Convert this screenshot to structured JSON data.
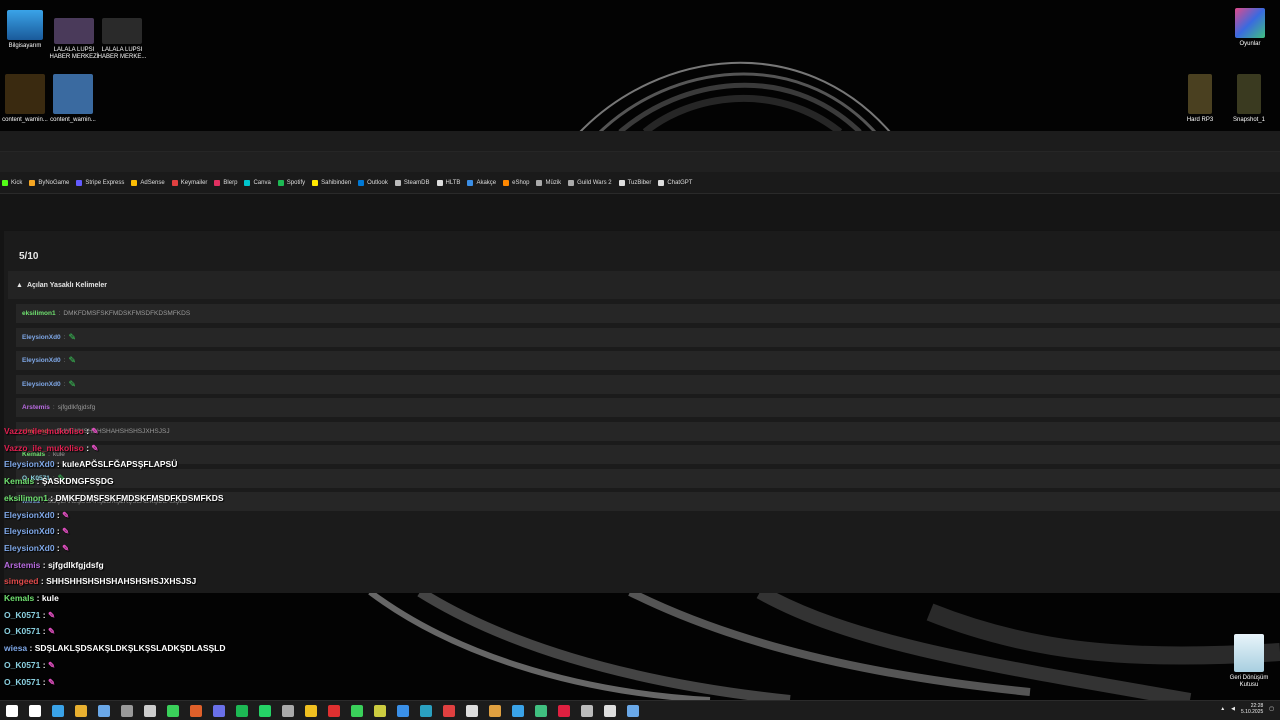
{
  "desktop": {
    "icons_left": [
      {
        "label": "Bilgisayarım",
        "color": "#3aa3e8"
      },
      {
        "label": "LALALA LUPSI HABER MERKEZİ",
        "color": "#4a3a5a"
      },
      {
        "label": "LALALA LUPSI HABER MERKE...",
        "color": "#2a2a2a"
      },
      {
        "label": "content_warnin...",
        "color": "#3a2a10"
      },
      {
        "label": "content_warnin...",
        "color": "#3a6aa0"
      }
    ],
    "icons_right": [
      {
        "label": "Oyunlar",
        "color": "#d04a8a"
      },
      {
        "label": "Hard RP3",
        "color": "#4a4020"
      },
      {
        "label": "Snapshot_1",
        "color": "#3a3a20"
      },
      {
        "label": "Geri Dönüşüm Kutusu",
        "color": "#cfe6f2"
      }
    ]
  },
  "browser": {
    "bookmarks": [
      {
        "label": "Kick",
        "color": "#53fc18"
      },
      {
        "label": "ByNoGame",
        "color": "#f5a623"
      },
      {
        "label": "Stripe Express",
        "color": "#635bff"
      },
      {
        "label": "AdSense",
        "color": "#fbbc04"
      },
      {
        "label": "Keymailer",
        "color": "#e04040"
      },
      {
        "label": "Blerp",
        "color": "#e03060"
      },
      {
        "label": "Canva",
        "color": "#00c4cc"
      },
      {
        "label": "Spotify",
        "color": "#1db954"
      },
      {
        "label": "Sahibinden",
        "color": "#ffe800"
      },
      {
        "label": "Outlook",
        "color": "#0078d4"
      },
      {
        "label": "SteamDB",
        "color": "#bbbbbb"
      },
      {
        "label": "HLTB",
        "color": "#dddddd"
      },
      {
        "label": "Akakçe",
        "color": "#3a8ee6"
      },
      {
        "label": "eShop",
        "color": "#ff8800"
      },
      {
        "label": "Müzik",
        "color": "#aaaaaa"
      },
      {
        "label": "Guild Wars 2",
        "color": "#aaaaaa"
      },
      {
        "label": "TuzBiber",
        "color": "#dddddd"
      },
      {
        "label": "ChatGPT",
        "color": "#dddddd"
      }
    ],
    "score": "5/10",
    "banned_header": "Açılan Yasaklı Kelimeler",
    "banned_rows": [
      {
        "user": "eksilimon1",
        "user_color": "#6fe06f",
        "message": "DMKFDMSFSKFMDSKFMSDFKDSMFKDS"
      },
      {
        "user": "EleysionXd0",
        "user_color": "#7fa8e8",
        "message": ""
      },
      {
        "user": "EleysionXd0",
        "user_color": "#7fa8e8",
        "message": ""
      },
      {
        "user": "EleysionXd0",
        "user_color": "#7fa8e8",
        "message": ""
      },
      {
        "user": "Arstemis",
        "user_color": "#b86be0",
        "message": "sjfgdlkfgjdsfg"
      },
      {
        "user": "simgeed",
        "user_color": "#e04a4a",
        "message": "SHHSHHSHSHSHAHSHSHSJXHSJSJ"
      },
      {
        "user": "Kemals",
        "user_color": "#6fe06f",
        "message": "kule"
      },
      {
        "user": "O_K0571",
        "user_color": "#8ad0e0",
        "message": ""
      },
      {
        "user": "wiesa",
        "user_color": "#7fa8e8",
        "message": "SDŞLAKLŞDSAKŞLDKŞLKŞSLADKŞDLASŞLD"
      }
    ]
  },
  "chat_overlay": [
    {
      "user": "Vazzo_ile_mukoliso",
      "user_color": "#e02050",
      "message": ""
    },
    {
      "user": "Vazzo_ile_mukoliso",
      "user_color": "#e02050",
      "message": ""
    },
    {
      "user": "EleysionXd0",
      "user_color": "#7fa8e8",
      "message": "kuleAPĞSLFĞAPSŞFLAPSÜ"
    },
    {
      "user": "Kemals",
      "user_color": "#6fe06f",
      "message": "ŞASKDNGFSŞDG"
    },
    {
      "user": "eksilimon1",
      "user_color": "#6fe06f",
      "message": "DMKFDMSFSKFMDSKFMSDFKDSMFKDS"
    },
    {
      "user": "EleysionXd0",
      "user_color": "#7fa8e8",
      "message": ""
    },
    {
      "user": "EleysionXd0",
      "user_color": "#7fa8e8",
      "message": ""
    },
    {
      "user": "EleysionXd0",
      "user_color": "#7fa8e8",
      "message": ""
    },
    {
      "user": "Arstemis",
      "user_color": "#b86be0",
      "message": "sjfgdlkfgjdsfg"
    },
    {
      "user": "simgeed",
      "user_color": "#e04a4a",
      "message": "SHHSHHSHSHSHAHSHSHSJXHSJSJ"
    },
    {
      "user": "Kemals",
      "user_color": "#6fe06f",
      "message": "kule"
    },
    {
      "user": "O_K0571",
      "user_color": "#8ad0e0",
      "message": ""
    },
    {
      "user": "O_K0571",
      "user_color": "#8ad0e0",
      "message": ""
    },
    {
      "user": "wiesa",
      "user_color": "#7fa8e8",
      "message": "SDŞLAKLŞDSAKŞLDKŞLKŞSLADKŞDLASŞLD"
    },
    {
      "user": "O_K0571",
      "user_color": "#8ad0e0",
      "message": ""
    },
    {
      "user": "O_K0571",
      "user_color": "#8ad0e0",
      "message": ""
    }
  ],
  "emote_color": "#3ad05a",
  "chat_emote_color": "#e050c0",
  "taskbar": {
    "apps": [
      {
        "name": "start-icon",
        "color": "#ffffff"
      },
      {
        "name": "search-icon",
        "color": "#ffffff"
      },
      {
        "name": "explorer-icon",
        "color": "#3aa3e8"
      },
      {
        "name": "chrome-icon",
        "color": "#e8b030"
      },
      {
        "name": "steam-icon",
        "color": "#6aa8e8"
      },
      {
        "name": "app-icon",
        "color": "#999999"
      },
      {
        "name": "obs-icon",
        "color": "#cccccc"
      },
      {
        "name": "xbox-icon",
        "color": "#3ad05a"
      },
      {
        "name": "firefox-icon",
        "color": "#e0602a"
      },
      {
        "name": "discord-icon",
        "color": "#6a70e8"
      },
      {
        "name": "spotify-icon",
        "color": "#1db954"
      },
      {
        "name": "whatsapp-icon",
        "color": "#25d366"
      },
      {
        "name": "app-icon",
        "color": "#aaaaaa"
      },
      {
        "name": "app-icon",
        "color": "#f0c020"
      },
      {
        "name": "app-icon",
        "color": "#e03030"
      },
      {
        "name": "app-icon",
        "color": "#3ad05a"
      },
      {
        "name": "app-icon",
        "color": "#cccc40"
      },
      {
        "name": "app-icon",
        "color": "#3a90e8"
      },
      {
        "name": "app-icon",
        "color": "#2aa0c0"
      },
      {
        "name": "app-icon",
        "color": "#e04040"
      },
      {
        "name": "app-icon",
        "color": "#dddddd"
      },
      {
        "name": "app-icon",
        "color": "#e0a040"
      },
      {
        "name": "app-icon",
        "color": "#3aa3e8"
      },
      {
        "name": "app-icon",
        "color": "#40c080"
      },
      {
        "name": "app-icon",
        "color": "#e02040"
      },
      {
        "name": "app-icon",
        "color": "#bbbbbb"
      },
      {
        "name": "app-icon",
        "color": "#dddddd"
      },
      {
        "name": "steam-icon",
        "color": "#6aa8e8"
      }
    ],
    "time": "22:28",
    "date": "5.10.2025"
  }
}
